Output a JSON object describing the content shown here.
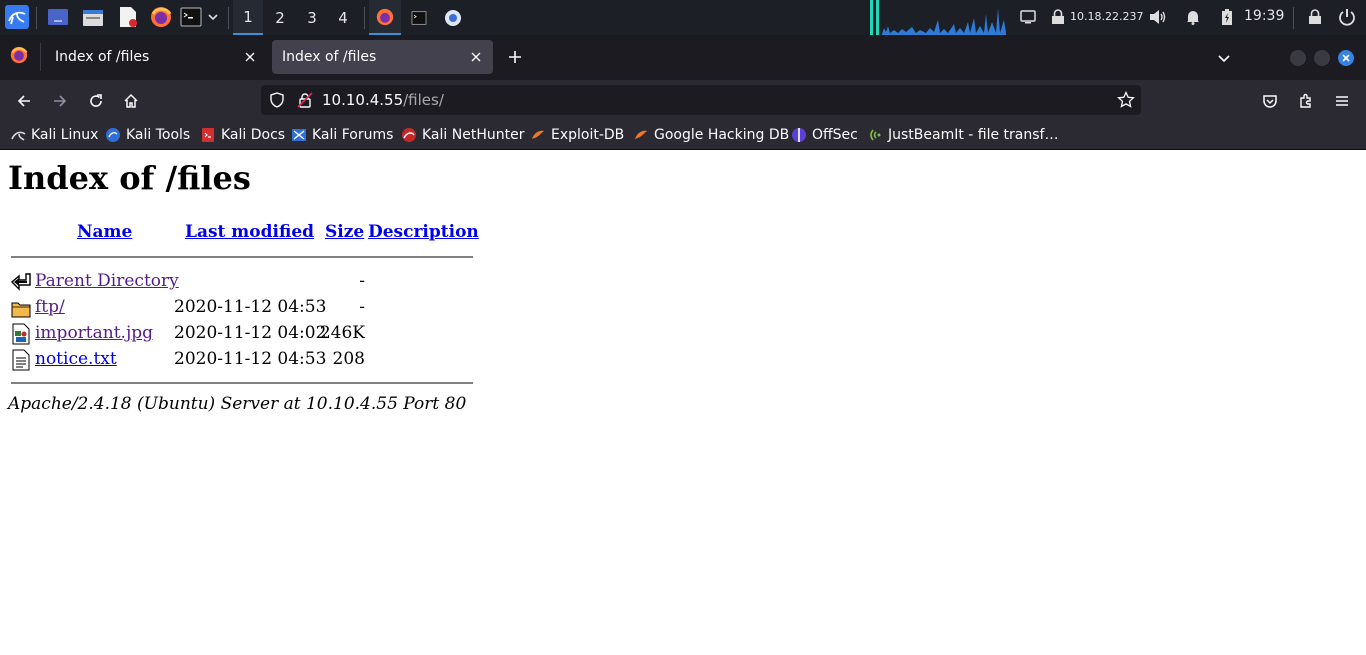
{
  "panel": {
    "workspaces": [
      "1",
      "2",
      "3",
      "4"
    ],
    "active_workspace": "1",
    "ip_address": "10.18.22.237",
    "clock": "19:39",
    "accent_color": "#3b8fd8"
  },
  "browser": {
    "tabs": [
      {
        "title": "Index of /files",
        "selected": false
      },
      {
        "title": "Index of /files",
        "selected": true
      }
    ],
    "url_host": "10.10.4.55",
    "url_path": "/files/",
    "bookmarks": [
      {
        "label": "Kali Linux",
        "icon": "kali-dragon-icon"
      },
      {
        "label": "Kali Tools",
        "icon": "kali-tools-icon"
      },
      {
        "label": "Kali Docs",
        "icon": "kali-docs-icon"
      },
      {
        "label": "Kali Forums",
        "icon": "kali-forums-icon"
      },
      {
        "label": "Kali NetHunter",
        "icon": "kali-nethunter-icon"
      },
      {
        "label": "Exploit-DB",
        "icon": "exploit-db-icon"
      },
      {
        "label": "Google Hacking DB",
        "icon": "ghdb-icon"
      },
      {
        "label": "OffSec",
        "icon": "offsec-icon"
      },
      {
        "label": "JustBeamIt - file transf…",
        "icon": "justbeamit-icon"
      }
    ]
  },
  "page": {
    "title": "Index of /files",
    "columns": [
      "Name",
      "Last modified",
      "Size",
      "Description"
    ],
    "entries": [
      {
        "name": "Parent Directory",
        "modified": "",
        "size": "-",
        "icon": "back-arrow-icon"
      },
      {
        "name": "ftp/",
        "modified": "2020-11-12 04:53",
        "size": "-",
        "icon": "folder-icon"
      },
      {
        "name": "important.jpg",
        "modified": "2020-11-12 04:02",
        "size": "246K",
        "icon": "image-file-icon"
      },
      {
        "name": "notice.txt",
        "modified": "2020-11-12 04:53",
        "size": "208",
        "icon": "text-file-icon"
      }
    ],
    "server_signature": "Apache/2.4.18 (Ubuntu) Server at 10.10.4.55 Port 80"
  }
}
